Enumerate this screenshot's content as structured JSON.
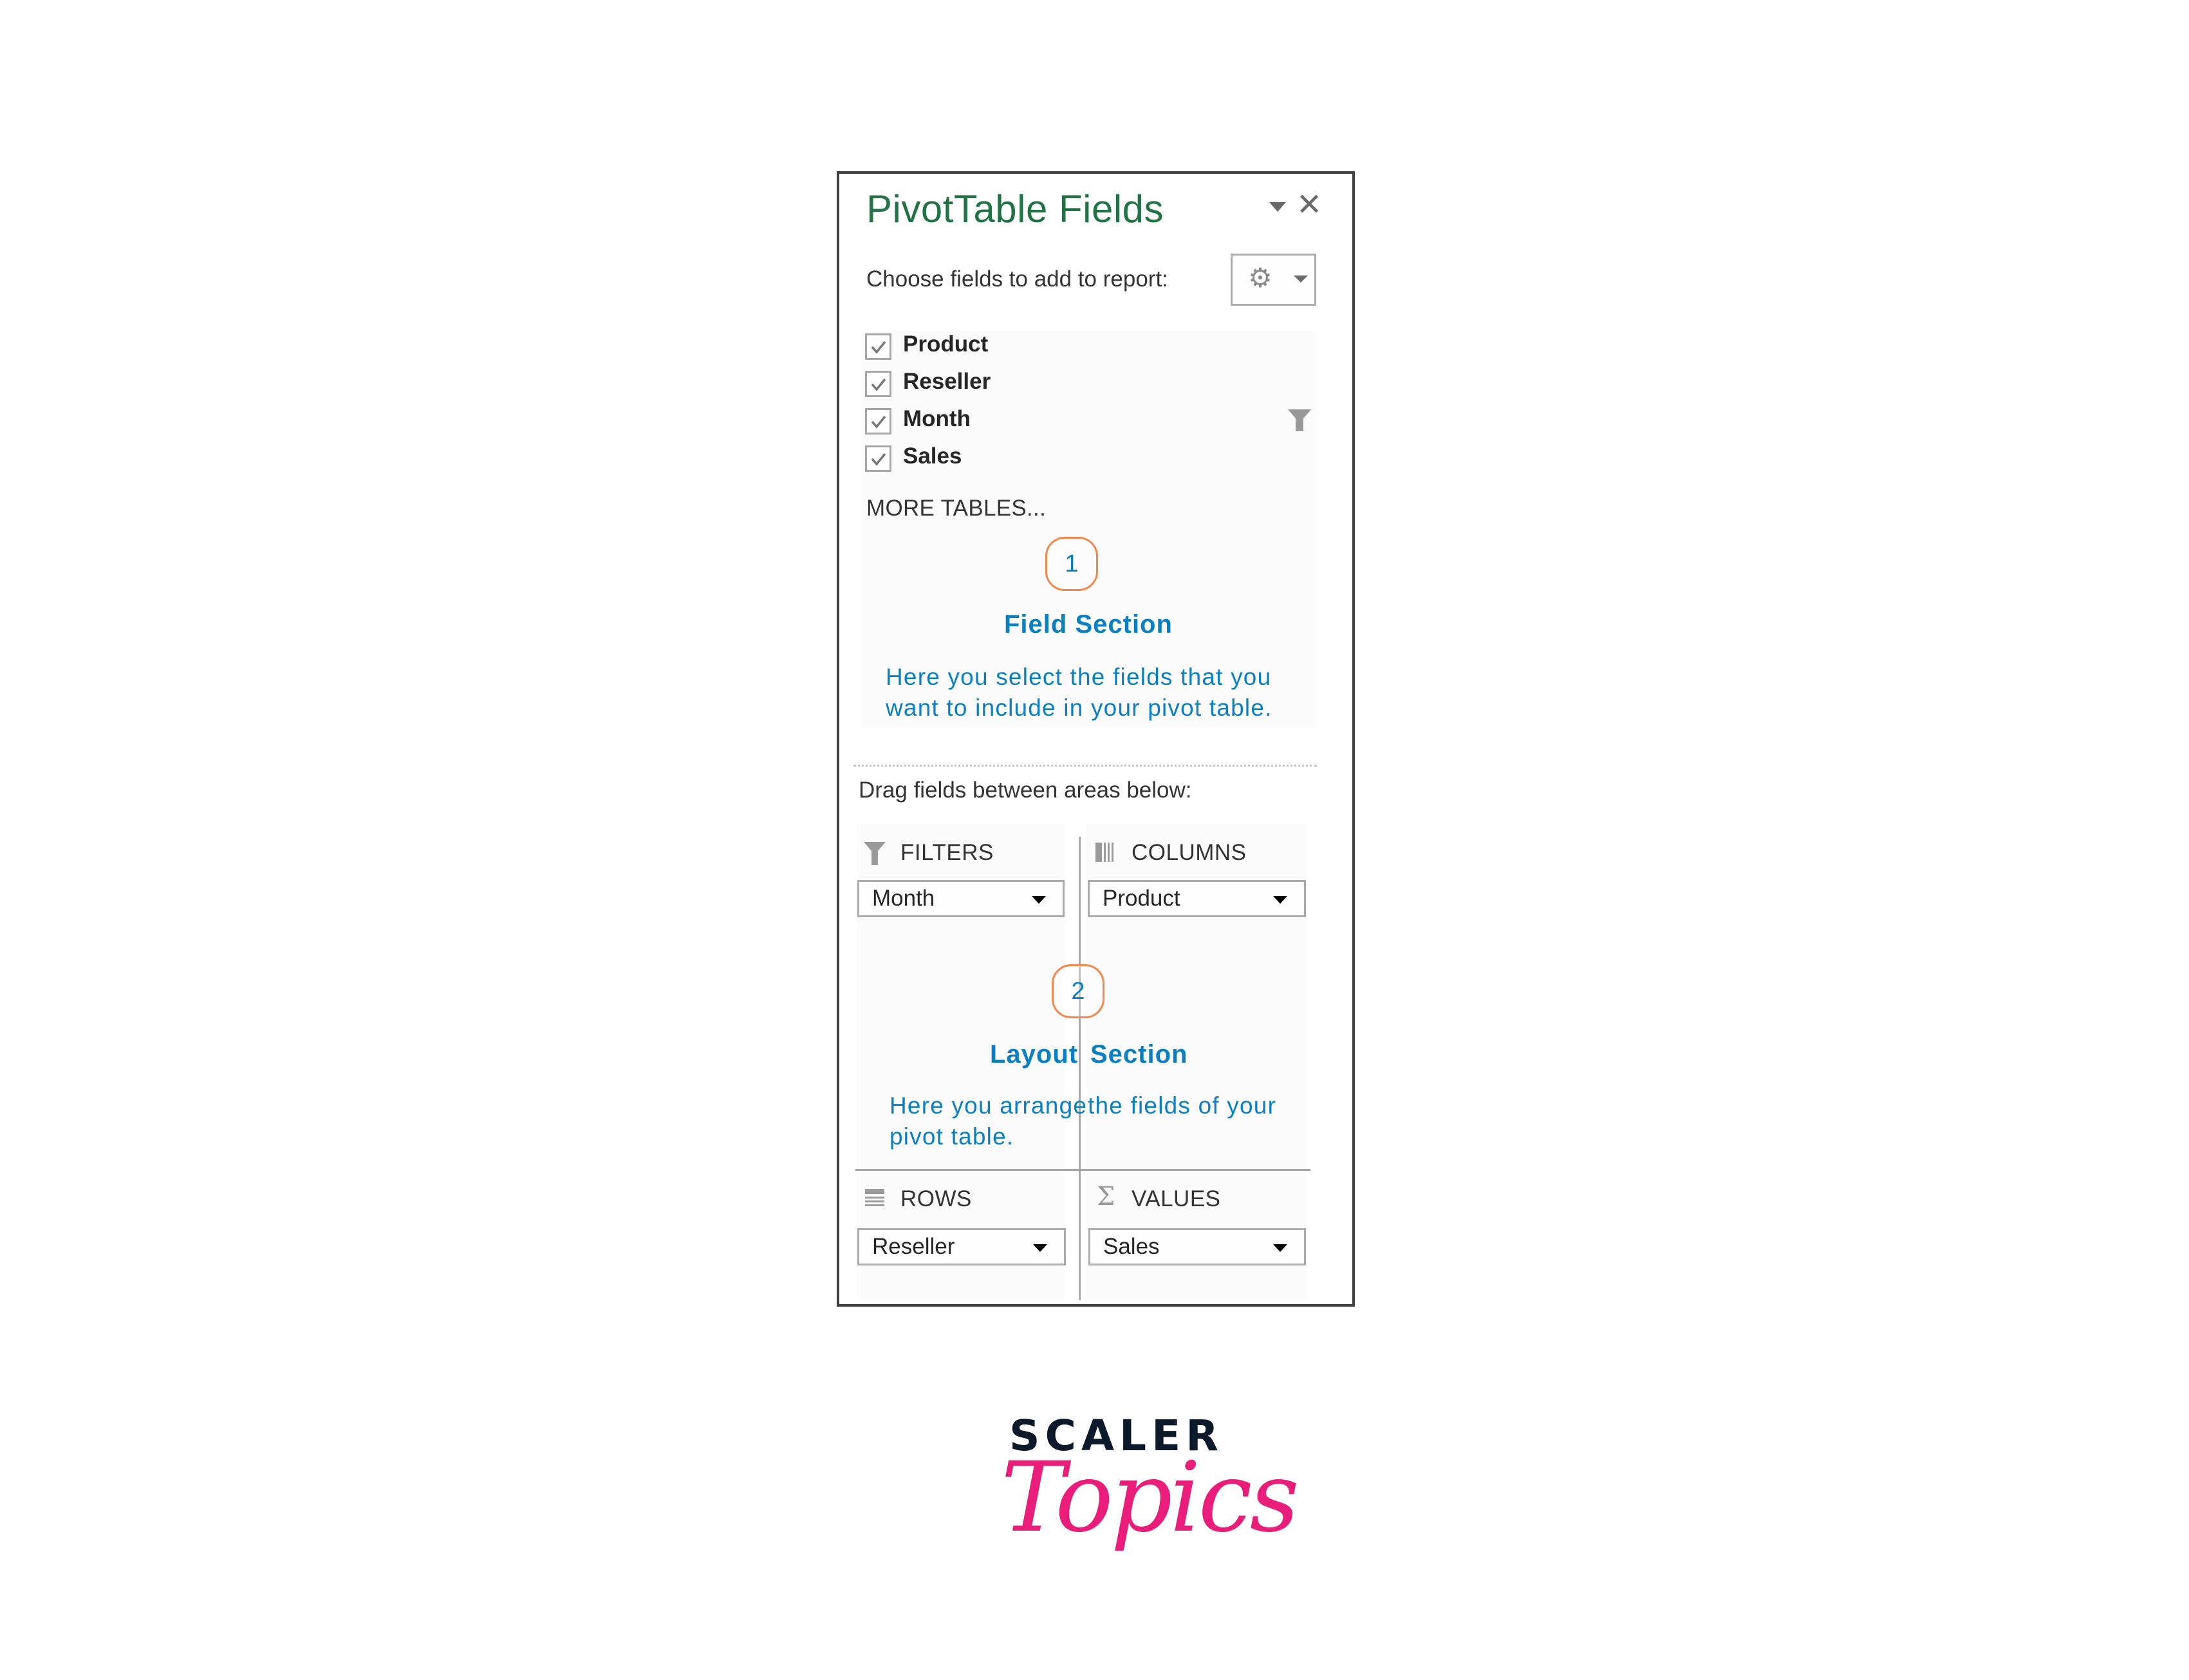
{
  "panel": {
    "title": "PivotTable Fields",
    "choose_label": "Choose fields to add to report:",
    "icons": {
      "pane_options": "triangle-down-icon",
      "close": "close-icon",
      "settings": "gear-icon"
    },
    "fields": [
      {
        "label": "Product",
        "checked": true,
        "filtered": false
      },
      {
        "label": "Reseller",
        "checked": true,
        "filtered": false
      },
      {
        "label": "Month",
        "checked": true,
        "filtered": true
      },
      {
        "label": "Sales",
        "checked": true,
        "filtered": false
      }
    ],
    "more_tables": "MORE TABLES...",
    "drag_label": "Drag fields between areas below:",
    "areas": {
      "filters": {
        "header": "FILTERS",
        "icon": "filter-icon",
        "value": "Month"
      },
      "columns": {
        "header": "COLUMNS",
        "icon": "columns-icon",
        "value": "Product"
      },
      "rows": {
        "header": "ROWS",
        "icon": "rows-icon",
        "value": "Reseller"
      },
      "values": {
        "header": "VALUES",
        "icon": "sigma-icon",
        "value": "Sales"
      }
    }
  },
  "annotations": [
    {
      "number": "1",
      "title": "Field Section",
      "description": "Here you select the fields that you want to include in your pivot table."
    },
    {
      "number": "2",
      "title_left": "Layout",
      "title_right": "Section",
      "description_line1_left": "Here you arrange",
      "description_line1_right": "the fields of your",
      "description_line2": "pivot table."
    }
  ],
  "logo": {
    "line1": "SCALER",
    "line2": "Topics"
  },
  "colors": {
    "title_green": "#217346",
    "annotation_blue": "#0a7fc1",
    "badge_orange": "#f4874b",
    "logo_pink": "#e91e7a",
    "logo_navy": "#0d1a2b"
  }
}
